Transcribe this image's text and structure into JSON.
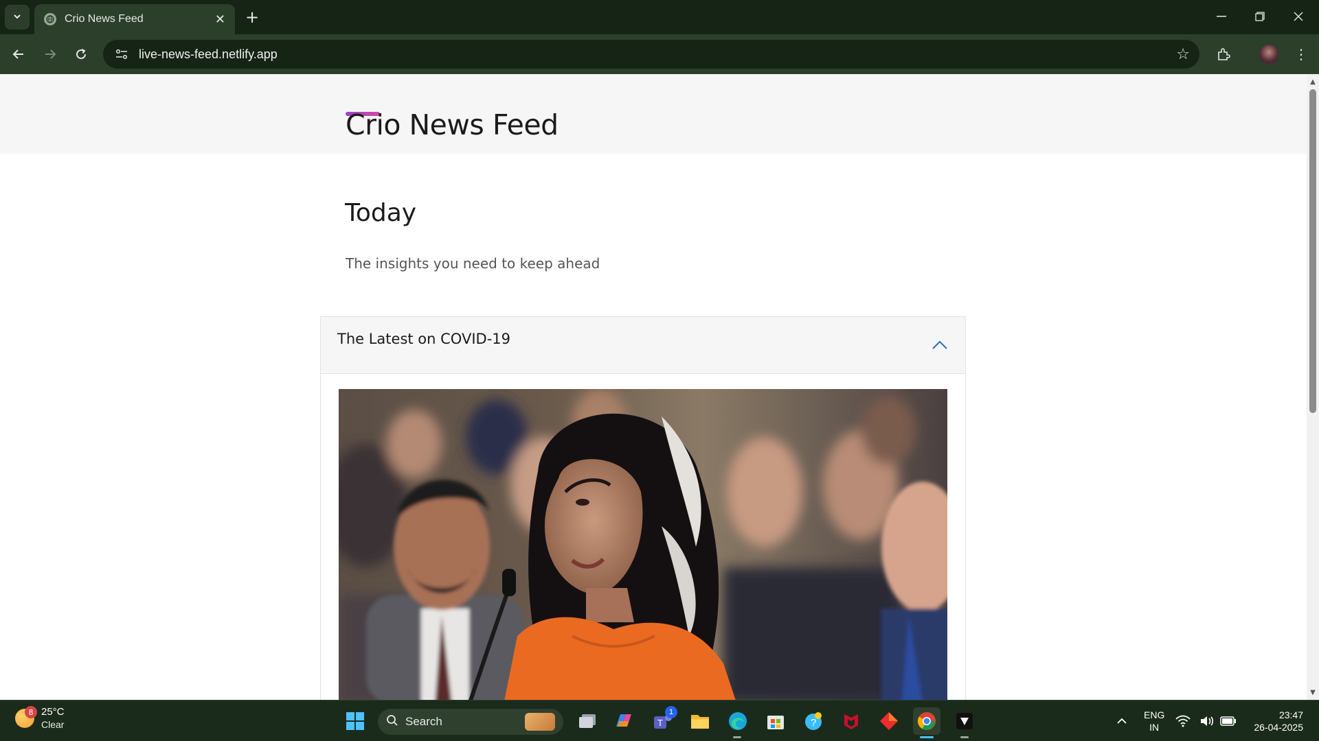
{
  "browser": {
    "tab_title": "Crio News Feed",
    "url": "live-news-feed.netlify.app"
  },
  "page": {
    "logo": "Crio News Feed",
    "heading": "Today",
    "subheading": "The insights you need to keep ahead",
    "accordion": {
      "title": "The Latest on COVID-19",
      "expanded": true
    }
  },
  "taskbar": {
    "weather_temp": "25°C",
    "weather_cond": "Clear",
    "weather_badge": "8",
    "search_placeholder": "Search",
    "teams_badge": "1",
    "lang_line1": "ENG",
    "lang_line2": "IN",
    "time": "23:47",
    "date": "26-04-2025"
  },
  "colors": {
    "chrome_bg": "#162416",
    "toolbar_bg": "#2b3f2b",
    "logo_accent": "#a040c8",
    "chevron": "#2a6fb3"
  }
}
